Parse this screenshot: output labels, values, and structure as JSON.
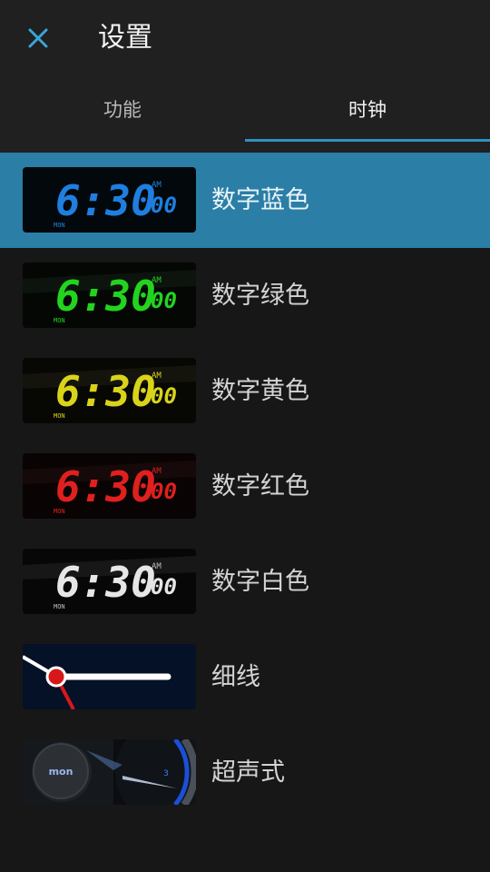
{
  "header": {
    "title": "设置",
    "tabs": [
      {
        "label": "功能",
        "active": false
      },
      {
        "label": "时钟",
        "active": true
      }
    ]
  },
  "clock_styles": [
    {
      "label": "数字蓝色",
      "selected": true,
      "thumb": {
        "time": "6:30",
        "seconds": "00",
        "ampm": "AM",
        "day": "MON",
        "color": "#1e7fe0"
      }
    },
    {
      "label": "数字绿色",
      "selected": false,
      "thumb": {
        "time": "6:30",
        "seconds": "00",
        "ampm": "AM",
        "day": "MON",
        "color": "#22d41e"
      }
    },
    {
      "label": "数字黄色",
      "selected": false,
      "thumb": {
        "time": "6:30",
        "seconds": "00",
        "ampm": "AM",
        "day": "MON",
        "color": "#d9d31a"
      }
    },
    {
      "label": "数字红色",
      "selected": false,
      "thumb": {
        "time": "6:30",
        "seconds": "00",
        "ampm": "AM",
        "day": "MON",
        "color": "#e01f1f"
      }
    },
    {
      "label": "数字白色",
      "selected": false,
      "thumb": {
        "time": "6:30",
        "seconds": "00",
        "ampm": "AM",
        "day": "MON",
        "color": "#e6e6e6"
      }
    },
    {
      "label": "细线",
      "selected": false
    },
    {
      "label": "超声式",
      "selected": false,
      "thumb": {
        "day": "mon",
        "date": "3"
      }
    }
  ],
  "colors": {
    "accent": "#2f93bf",
    "selected_row": "#2b7ea6",
    "close_icon": "#3aa6d8"
  }
}
